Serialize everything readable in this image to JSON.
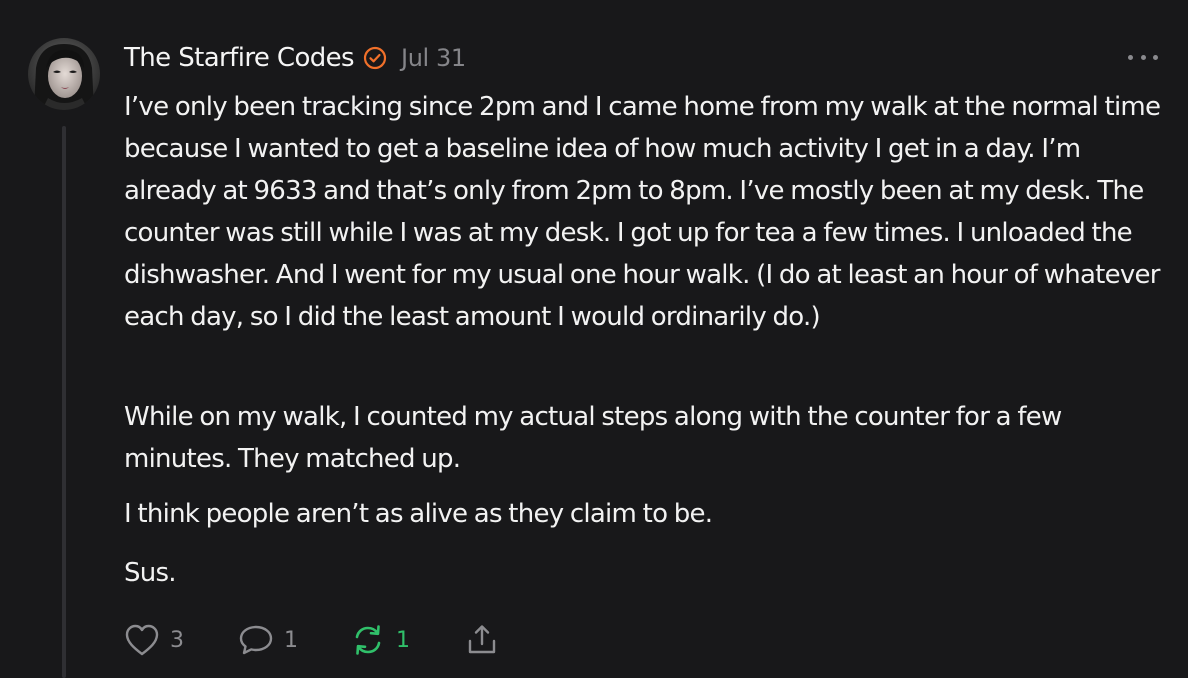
{
  "note": {
    "author": "The Starfire Codes",
    "date": "Jul 31",
    "paragraphs": [
      "I’ve only been tracking since 2pm and I came home from my walk at the normal time because I wanted to get a baseline idea of how much activity I get in a day. I’m already at 9633 and that’s only from 2pm to 8pm. I’ve mostly been at my desk. The counter was still while I was at my desk. I got up for tea a few times. I unloaded the dishwasher. And I went for my usual one hour walk. (I do at least an hour of whatever each day, so I did the least amount I would ordinarily do.)",
      "While on my walk, I counted my actual steps along with the counter for a few minutes. They matched up.",
      "I think people aren’t as alive as they claim to be.",
      "Sus."
    ],
    "likes": "3",
    "comments": "1",
    "restacks": "1"
  },
  "icons": {
    "verified": "verified-check-icon",
    "more": "more-horizontal-icon",
    "like": "heart-icon",
    "comment": "speech-bubble-icon",
    "restack": "restack-arrows-icon",
    "share": "share-upload-icon"
  },
  "colors": {
    "background": "#18181a",
    "text": "#f2f2f2",
    "muted": "#858589",
    "verified": "#f0702a",
    "restack_active": "#30c06a",
    "thread_line": "#2f2f33"
  }
}
